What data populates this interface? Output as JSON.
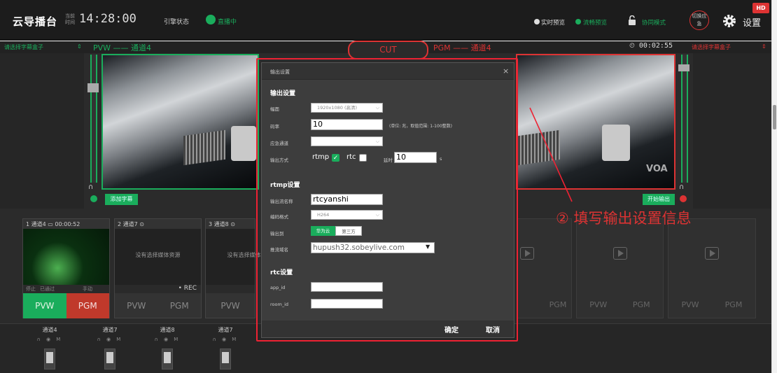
{
  "header": {
    "brand": "云导播台",
    "clock_caption": "当前时间",
    "clock": "14:28:00",
    "engine_label": "引擎状态",
    "engine_value": "直播中",
    "realtime_preview": "实时预览",
    "smooth_preview": "流畅预览",
    "coop_mode": "协同模式",
    "switch_button": "切换应急",
    "settings": "设置",
    "badge": "HD"
  },
  "preview": {
    "left_subtitle_select": "请选择字幕盒子",
    "arrow": "⇕",
    "pvw_title": "PVW —— 通道4",
    "pgm_title": "PGM —— 通道4",
    "cut": "CUT",
    "timer": "⏲ 00:02:55",
    "right_subtitle_select": "请选择字幕盒子",
    "add_subtitle": "添加字幕",
    "start_output": "开始输出",
    "watermark": "VOA"
  },
  "tiles": [
    {
      "head": "1 通道4 ▭   00:00:52",
      "buttons": [
        "PVW",
        "PGM"
      ],
      "controls": [
        "停止",
        "已通过",
        "手动"
      ]
    },
    {
      "head": "2 通道7 ⊙",
      "empty": "没有选择媒体资源",
      "rec": "• REC",
      "buttons": [
        "PVW",
        "PGM"
      ]
    },
    {
      "head": "3 通道8 ⊙",
      "empty": "没有选择媒体资源",
      "buttons": [
        "PVW"
      ]
    }
  ],
  "empty_tiles": [
    {
      "buttons": [
        "",
        "PGM"
      ]
    },
    {
      "buttons": [
        "PVW",
        "PGM"
      ]
    },
    {
      "buttons": [
        "PVW",
        "PGM"
      ]
    }
  ],
  "mixer": [
    {
      "name": "通道4",
      "icons": "∩ ◉ M"
    },
    {
      "name": "通道7",
      "icons": "∩ ◉ M"
    },
    {
      "name": "通道8",
      "icons": "∩ ◉ M"
    },
    {
      "name": "通道7",
      "icons": "∩ ◉ M"
    }
  ],
  "annotation": "② 填写输出设置信息",
  "modal": {
    "title": "输出设置",
    "close": "×",
    "section_output": "输出设置",
    "resolution_label": "幅面",
    "resolution_value": "1920x1080 (高清)",
    "bitrate_label": "码率",
    "bitrate_value": "10",
    "bitrate_hint": "(单位: 兆，取值范围: 1-100整数)",
    "backup_label": "应急通道",
    "backup_value": "",
    "output_mode_label": "输出方式",
    "rtmp_label": "rtmp",
    "rtmp_checked": true,
    "rtc_label": "rtc",
    "rtc_checked": false,
    "delay_label": "延时",
    "delay_value": "10",
    "delay_unit": "s",
    "section_rtmp": "rtmp设置",
    "stream_name_label": "输出流名称",
    "stream_name_value": "rtcyanshi",
    "codec_label": "编码格式",
    "codec_value": "H264",
    "output_to_label": "输出到",
    "output_to_options": [
      "华为云",
      "第三方"
    ],
    "output_to_selected": "华为云",
    "push_domain_label": "推流域名",
    "push_domain_value": "hupush32.sobeylive.com",
    "section_rtc": "rtc设置",
    "app_id_label": "app_id",
    "app_id_value": "",
    "room_id_label": "room_id",
    "room_id_value": "",
    "confirm": "确定",
    "cancel": "取消"
  },
  "colors": {
    "accent_green": "#1aad5c",
    "accent_red": "#d33",
    "annotation_red": "#e23"
  }
}
